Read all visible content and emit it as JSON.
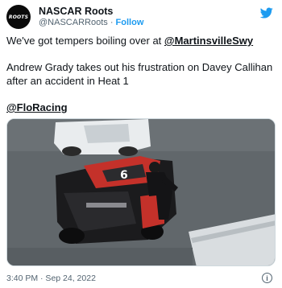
{
  "author": {
    "display_name": "NASCAR Roots",
    "handle": "@NASCARRoots",
    "separator": "·",
    "follow_label": "Follow",
    "avatar_text": "ROOTS"
  },
  "tweet": {
    "line1_text": "We've got tempers boiling over at ",
    "line1_mention": "@MartinsvilleSwy",
    "line2_text": "Andrew Grady takes out his frustration on Davey Callihan after an accident in Heat 1",
    "line3_mention": "@FloRacing"
  },
  "media": {
    "description_icon": "video-frame",
    "car_number": "6"
  },
  "footer": {
    "timestamp": "3:40 PM · Sep 24, 2022",
    "info_icon": "i"
  },
  "colors": {
    "accent": "#1d9bf0",
    "text": "#0f1419",
    "muted": "#536471"
  }
}
